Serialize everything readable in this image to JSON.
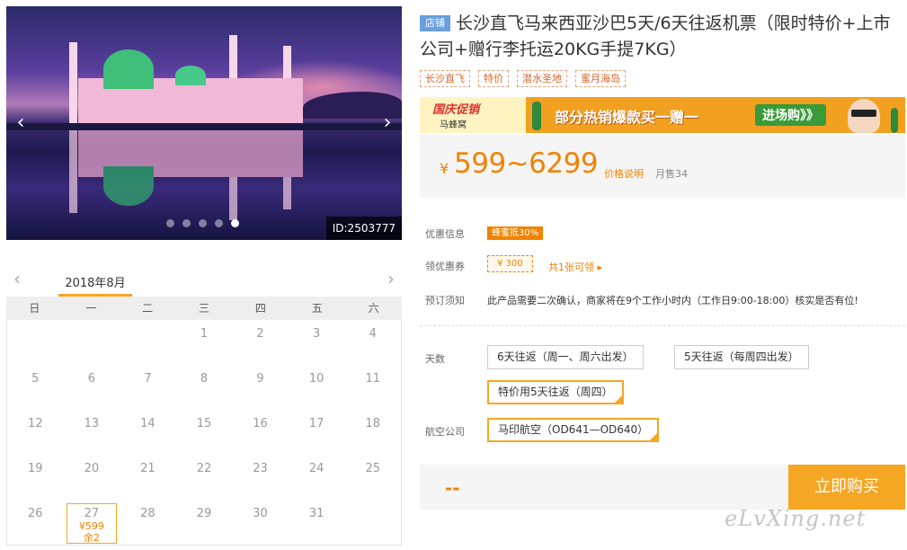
{
  "gallery": {
    "photo_id": "ID:2503777",
    "prev_icon": "chevron-left-icon",
    "next_icon": "chevron-right-icon",
    "slide_count": 5,
    "active_slide": 5
  },
  "calendar": {
    "month": "2018年8月",
    "weekdays": [
      "日",
      "一",
      "二",
      "三",
      "四",
      "五",
      "六"
    ],
    "rows": [
      [
        "",
        "",
        "",
        "1",
        "2",
        "3",
        "4"
      ],
      [
        "5",
        "6",
        "7",
        "8",
        "9",
        "10",
        "11"
      ],
      [
        "12",
        "13",
        "14",
        "15",
        "16",
        "17",
        "18"
      ],
      [
        "19",
        "20",
        "21",
        "22",
        "23",
        "24",
        "25"
      ],
      [
        "26",
        "27",
        "28",
        "29",
        "30",
        "31",
        ""
      ]
    ],
    "selected": {
      "day": "27",
      "price": "¥599",
      "remaining": "余2"
    }
  },
  "product": {
    "store_tag": "店铺",
    "title": "长沙直飞马来西亚沙巴5天/6天往返机票（限时特价+上市公司+赠行李托运20KG手提7KG）",
    "tags": [
      "长沙直飞",
      "特价",
      "潜水圣地",
      "蜜月海岛"
    ]
  },
  "banner": {
    "brand_title": "国庆促销",
    "brand_sub": "马蜂窝",
    "headline": "部分热销爆款买一赠一",
    "cta": "进场购》》"
  },
  "price": {
    "currency": "¥",
    "range": "599~6299",
    "note_link": "价格说明",
    "sold": "月售34"
  },
  "info": {
    "discount_label": "优惠信息",
    "discount_value": "蜂蜜抵30%",
    "coupon_label": "领优惠券",
    "coupon_value": "¥ 300",
    "coupon_link": "共1张可领 ▸",
    "notice_label": "预订须知",
    "notice_value": "此产品需要二次确认，商家将在9个工作小时内（工作日9:00-18:00）核实是否有位!"
  },
  "options": {
    "days_label": "天数",
    "days": [
      {
        "label": "6天往返（周一、周六出发）",
        "selected": false
      },
      {
        "label": "5天往返（每周四出发）",
        "selected": false
      },
      {
        "label": "特价用5天往返（周四）",
        "selected": true
      }
    ],
    "airline_label": "航空公司",
    "airline": {
      "label": "马印航空（OD641—OD640）",
      "selected": true
    }
  },
  "purchase": {
    "placeholder_price": "--",
    "buy_label": "立即购买"
  },
  "watermark": "eLvXing.net",
  "colors": {
    "accent": "#f08300",
    "button": "#f5a623",
    "store_tag": "#6a9ee0"
  }
}
